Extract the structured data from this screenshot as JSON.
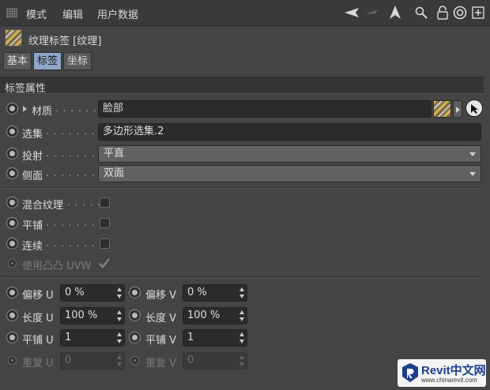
{
  "menubar": {
    "items": [
      "模式",
      "编辑",
      "用户数据"
    ],
    "icons": [
      "back-arrow-icon",
      "forward-arrow-icon",
      "cursor-up-icon",
      "search-icon",
      "lock-icon",
      "target-icon",
      "new-window-icon"
    ]
  },
  "tag": {
    "title": "纹理标签 [纹理]"
  },
  "tabs": [
    "基本",
    "标签",
    "坐标"
  ],
  "active_tab": "标签",
  "section": {
    "title": "标签属性"
  },
  "fields": {
    "material": {
      "label": "材质",
      "dots": ". . . . . . .",
      "value": "脸部"
    },
    "selection": {
      "label": "选集",
      "dots": ". . . . . . . . .",
      "value": "多边形选集.2"
    },
    "projection": {
      "label": "投射",
      "dots": ". . . . . . . . .",
      "value": "平直"
    },
    "side": {
      "label": "侧面",
      "dots": ". . . . . . . . .",
      "value": "双面"
    }
  },
  "checks": {
    "mix_textures": {
      "label": "混合纹理",
      "dots": ". . . . .",
      "checked": false
    },
    "tile": {
      "label": "平铺",
      "dots": ". . . . . . . .",
      "checked": false
    },
    "seamless": {
      "label": "连续",
      "dots": ". . . . . . . .",
      "checked": false
    },
    "use_bump_uvw": {
      "label": "使用凸凸 UVW",
      "checked": true,
      "enabled": false
    }
  },
  "uv": {
    "offset_u": {
      "label": "偏移 U",
      "value": "0 %"
    },
    "offset_v": {
      "label": "偏移 V",
      "value": "0 %"
    },
    "length_u": {
      "label": "长度 U",
      "value": "100 %"
    },
    "length_v": {
      "label": "长度 V",
      "value": "100 %"
    },
    "tiles_u": {
      "label": "平铺 U",
      "value": "1"
    },
    "tiles_v": {
      "label": "平铺 V",
      "value": "1"
    },
    "repeat_u": {
      "label": "重复 U",
      "value": "0"
    },
    "repeat_v": {
      "label": "重复 V",
      "value": "0"
    }
  },
  "watermark": {
    "title": "Revit中文网",
    "url": "www.chinarevit.com"
  },
  "colors": {
    "background": "#444444",
    "active_tab": "#8fa7c7",
    "field": "#2b2b2b"
  }
}
